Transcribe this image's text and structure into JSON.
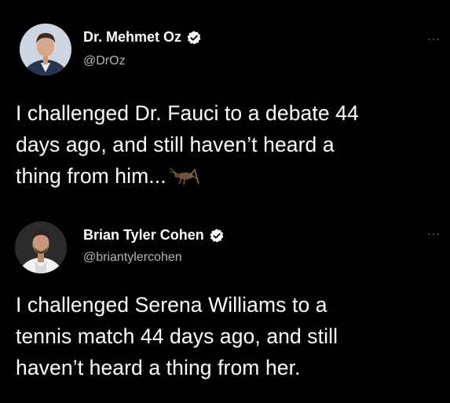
{
  "tweets": [
    {
      "display_name": "Dr. Mehmet Oz",
      "handle": "@DrOz",
      "verified": true,
      "more_label": "···",
      "text_lines": [
        "I challenged Dr. Fauci to a debate 44",
        "days ago, and still haven’t heard a",
        "thing from him..."
      ],
      "emoji": "cricket-icon"
    },
    {
      "display_name": "Brian Tyler Cohen",
      "handle": "@briantylercohen",
      "verified": true,
      "more_label": "···",
      "text_lines": [
        "I challenged Serena Williams to a",
        "tennis match 44 days ago, and still",
        "haven’t heard a thing from her."
      ]
    }
  ],
  "colors": {
    "background": "#000000",
    "text": "#ffffff",
    "handle": "#b6b6b6",
    "verified_badge": "#ffffff"
  }
}
